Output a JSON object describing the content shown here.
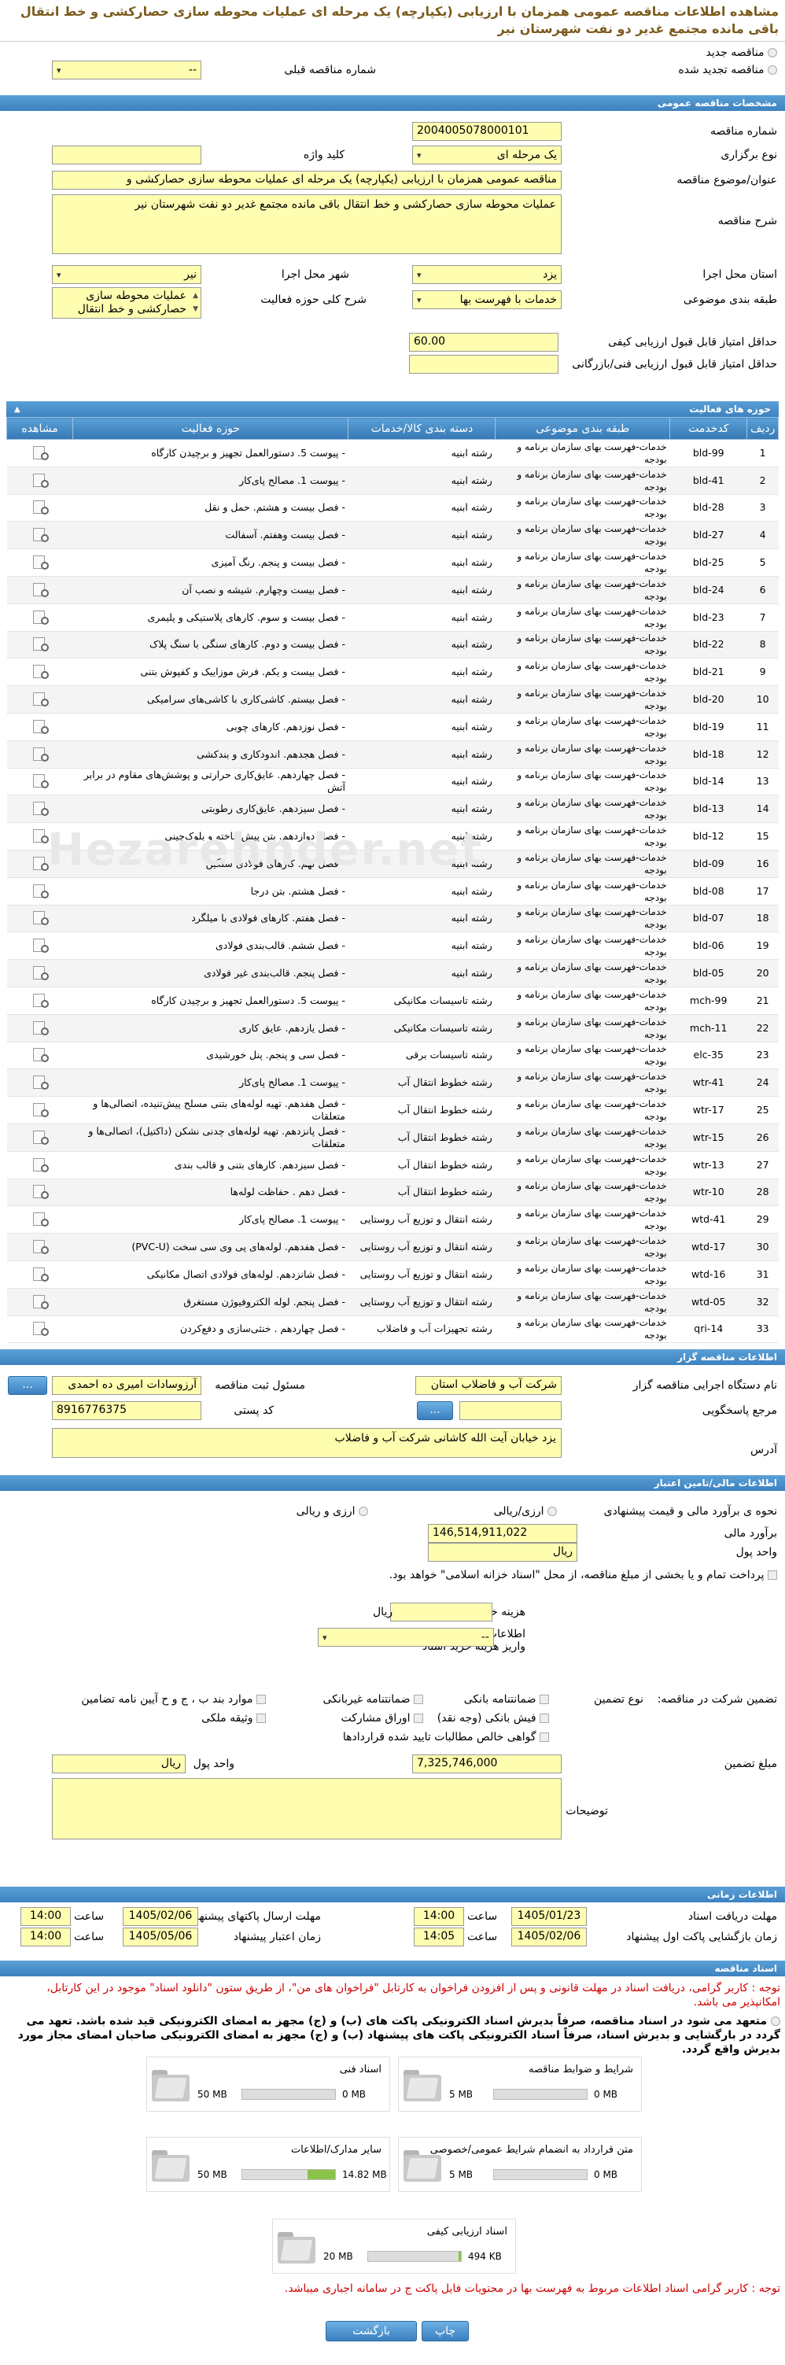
{
  "page_title": "مشاهده اطلاعات مناقصه عمومی همزمان با ارزیابی (یکپارچه) یک مرحله ای عملیات محوطه سازی حصارکشی و خط انتقال باقی مانده مجتمع غدیر دو نفت شهرستان نیر",
  "top": {
    "new_tender": "مناقصه جدید",
    "renewed_tender": "مناقصه تجدید شده",
    "prev_number_label": "شماره مناقصه قبلی",
    "prev_number_value": "--"
  },
  "general": {
    "section": "مشخصات مناقصه عمومی",
    "number_label": "شماره مناقصه",
    "number_value": "2004005078000101",
    "type_label": "نوع برگزاری",
    "type_value": "یک مرحله ای",
    "keyword_label": "کلید واژه",
    "subject_label": "عنوان/موضوع مناقصه",
    "subject_value": "مناقصه عمومی همزمان با ارزیابی (یکپارچه) یک مرحله ای عملیات محوطه سازی حصارکشی و",
    "desc_label": "شرح مناقصه",
    "desc_value": "عملیات محوطه سازی حصارکشی و خط انتقال باقی مانده مجتمع غدیر دو نفت شهرستان نیر",
    "province_label": "استان محل اجرا",
    "province_value": "یزد",
    "city_label": "شهر محل اجرا",
    "city_value": "نیر",
    "category_label": "طبقه بندی موضوعی",
    "category_value": "خدمات با فهرست بها",
    "scope_label": "شرح کلی حوزه فعالیت",
    "scope_value": "عملیات محوطه سازی حصارکشی و خط انتقال",
    "min_score_label": "حداقل امتیاز قابل قبول ارزیابی کیفی",
    "min_score_value": "60.00",
    "min_tech_label": "حداقل امتیاز قابل قبول ارزیابی فنی/بازرگانی"
  },
  "activities": {
    "section": "حوزه های فعالیت",
    "headers": [
      "ردیف",
      "کدخدمت",
      "طبقه بندی موضوعی",
      "دسته بندی کالا/خدمات",
      "حوزه فعالیت",
      "مشاهده"
    ],
    "rows": [
      [
        "1",
        "bld-99",
        "خدمات-فهرست بهای سازمان برنامه و بودجه",
        "رشته ابنیه",
        "- پیوست 5. دستورالعمل تجهیز و برچیدن کارگاه"
      ],
      [
        "2",
        "bld-41",
        "خدمات-فهرست بهای سازمان برنامه و بودجه",
        "رشته ابنیه",
        "- پیوست 1. مصالح پای‌کار"
      ],
      [
        "3",
        "bld-28",
        "خدمات-فهرست بهای سازمان برنامه و بودجه",
        "رشته ابنیه",
        "- فصل بیست و هشتم. حمل و نقل"
      ],
      [
        "4",
        "bld-27",
        "خدمات-فهرست بهای سازمان برنامه و بودجه",
        "رشته ابنیه",
        "- فصل بیست وهفتم. آسفالت"
      ],
      [
        "5",
        "bld-25",
        "خدمات-فهرست بهای سازمان برنامه و بودجه",
        "رشته ابنیه",
        "- فصل بیست و پنجم. رنگ آمیزی"
      ],
      [
        "6",
        "bld-24",
        "خدمات-فهرست بهای سازمان برنامه و بودجه",
        "رشته ابنیه",
        "- فصل بیست وچهارم. شیشه و نصب آن"
      ],
      [
        "7",
        "bld-23",
        "خدمات-فهرست بهای سازمان برنامه و بودجه",
        "رشته ابنیه",
        "- فصل بیست و سوم. کارهای پلاستیکی و پلیمری"
      ],
      [
        "8",
        "bld-22",
        "خدمات-فهرست بهای سازمان برنامه و بودجه",
        "رشته ابنیه",
        "- فصل بیست و دوم. کارهای سنگی با سنگ پلاک"
      ],
      [
        "9",
        "bld-21",
        "خدمات-فهرست بهای سازمان برنامه و بودجه",
        "رشته ابنیه",
        "- فصل بیست و یکم. فرش موزاییک و کفپوش بتنی"
      ],
      [
        "10",
        "bld-20",
        "خدمات-فهرست بهای سازمان برنامه و بودجه",
        "رشته ابنیه",
        "- فصل بیستم. کاشی‌کاری با کاشی‌های سرامیکی"
      ],
      [
        "11",
        "bld-19",
        "خدمات-فهرست بهای سازمان برنامه و بودجه",
        "رشته ابنیه",
        "- فصل نوزدهم. کارهای چوبی"
      ],
      [
        "12",
        "bld-18",
        "خدمات-فهرست بهای سازمان برنامه و بودجه",
        "رشته ابنیه",
        "- فصل هجدهم. اندودکاری و بندکشی"
      ],
      [
        "13",
        "bld-14",
        "خدمات-فهرست بهای سازمان برنامه و بودجه",
        "رشته ابنیه",
        "- فصل چهاردهم. عایق‌کاری حرارتی و پوشش‌های مقاوم در برابر آتش"
      ],
      [
        "14",
        "bld-13",
        "خدمات-فهرست بهای سازمان برنامه و بودجه",
        "رشته ابنیه",
        "- فصل سیزدهم. عایق‌کاری رطوبتی"
      ],
      [
        "15",
        "bld-12",
        "خدمات-فهرست بهای سازمان برنامه و بودجه",
        "رشته ابنیه",
        "- فصل دوازدهم. بتن پیش‌ساخته و بلوک‌چینی"
      ],
      [
        "16",
        "bld-09",
        "خدمات-فهرست بهای سازمان برنامه و بودجه",
        "رشته ابنیه",
        "- فصل نهم. کارهای فولادی سنگین"
      ],
      [
        "17",
        "bld-08",
        "خدمات-فهرست بهای سازمان برنامه و بودجه",
        "رشته ابنیه",
        "- فصل هشتم. بتن درجا"
      ],
      [
        "18",
        "bld-07",
        "خدمات-فهرست بهای سازمان برنامه و بودجه",
        "رشته ابنیه",
        "- فصل هفتم. کارهای فولادی با میلگرد"
      ],
      [
        "19",
        "bld-06",
        "خدمات-فهرست بهای سازمان برنامه و بودجه",
        "رشته ابنیه",
        "- فصل ششم. قالب‌بندی فولادی"
      ],
      [
        "20",
        "bld-05",
        "خدمات-فهرست بهای سازمان برنامه و بودجه",
        "رشته ابنیه",
        "- فصل پنجم. قالب‌بندی غیر فولادی"
      ],
      [
        "21",
        "mch-99",
        "خدمات-فهرست بهای سازمان برنامه و بودجه",
        "رشته تاسیسات مکانیکی",
        "- پیوست 5. دستورالعمل تجهیز و برچیدن کارگاه"
      ],
      [
        "22",
        "mch-11",
        "خدمات-فهرست بهای سازمان برنامه و بودجه",
        "رشته تاسیسات مکانیکی",
        "- فصل یازدهم. عایق کاری"
      ],
      [
        "23",
        "elc-35",
        "خدمات-فهرست بهای سازمان برنامه و بودجه",
        "رشته تاسیسات برقی",
        "- فصل سی و پنجم. پنل خورشیدی"
      ],
      [
        "24",
        "wtr-41",
        "خدمات-فهرست بهای سازمان برنامه و بودجه",
        "رشته خطوط انتقال آب",
        "- پیوست 1. مصالح پای‌کار"
      ],
      [
        "25",
        "wtr-17",
        "خدمات-فهرست بهای سازمان برنامه و بودجه",
        "رشته خطوط انتقال آب",
        "- فصل هفدهم. تهیه لوله‌های بتنی مسلح پیش‌تنیده، اتصالی‌ها و متعلقات"
      ],
      [
        "26",
        "wtr-15",
        "خدمات-فهرست بهای سازمان برنامه و بودجه",
        "رشته خطوط انتقال آب",
        "- فصل پانزدهم. تهیه لوله‌های چدنی نشکن (داکتیل)، اتصالی‌ها و متعلقات"
      ],
      [
        "27",
        "wtr-13",
        "خدمات-فهرست بهای سازمان برنامه و بودجه",
        "رشته خطوط انتقال آب",
        "- فصل سیزدهم. کارهای بتنی و قالب بندی"
      ],
      [
        "28",
        "wtr-10",
        "خدمات-فهرست بهای سازمان برنامه و بودجه",
        "رشته خطوط انتقال آب",
        "- فصل دهم . حفاظت لوله‌ها"
      ],
      [
        "29",
        "wtd-41",
        "خدمات-فهرست بهای سازمان برنامه و بودجه",
        "رشته انتقال و توزیع آب روستایی",
        "- پیوست 1. مصالح پای‌کار"
      ],
      [
        "30",
        "wtd-17",
        "خدمات-فهرست بهای سازمان برنامه و بودجه",
        "رشته انتقال و توزیع آب روستایی",
        "- فصل هفدهم. لوله‌های پی وی سی سخت (PVC-U)"
      ],
      [
        "31",
        "wtd-16",
        "خدمات-فهرست بهای سازمان برنامه و بودجه",
        "رشته انتقال و توزیع آب روستایی",
        "- فصل شانزدهم. لوله‌های فولادی اتصال مکانیکی"
      ],
      [
        "32",
        "wtd-05",
        "خدمات-فهرست بهای سازمان برنامه و بودجه",
        "رشته انتقال و توزیع آب روستایی",
        "- فصل پنجم. لوله الکتروفیوژن مستغرق"
      ],
      [
        "33",
        "qri-14",
        "خدمات-فهرست بهای سازمان برنامه و بودجه",
        "رشته تجهیزات آب و فاضلاب",
        "- فصل چهاردهم . خنثی‌سازی و دفع‌کردن"
      ]
    ]
  },
  "organizer": {
    "section": "اطلاعات مناقصه گزار",
    "org_label": "نام دستگاه اجرایی مناقصه گزار",
    "org_value": "شرکت آب و فاضلاب استان",
    "registrar_label": "مسئول ثبت مناقصه",
    "registrar_value": "آرزوسادات امیری ده احمدی",
    "ref_label": "مرجع پاسخگویی",
    "btn_dots": "...",
    "postal_label": "کد پستی",
    "postal_value": "8916776375",
    "address_label": "آدرس",
    "address_value": "یزد خیابان آیت الله کاشانی شرکت آب و فاضلاب"
  },
  "financial": {
    "section": "اطلاعات مالی/تامین اعتبار",
    "method_label": "نحوه ی برآورد مالی و قیمت پیشنهادی",
    "rial": "ارزی/ریالی",
    "rial_fx": "ارزی و ریالی",
    "estimate_label": "برآورد مالی",
    "estimate_value": "146,514,911,022",
    "unit_label": "واحد پول",
    "unit_value": "ریال",
    "treasury_note": "پرداخت تمام و یا بخشی از مبلغ مناقصه، از محل \"اسناد خزانه اسلامی\" خواهد بود.",
    "purchase_cost_label": "هزینه خرید اسناد",
    "purchase_cost_unit": "ریال",
    "account_label": "اطلاعات حساب جهت واریز هزینه خرید اسناد",
    "account_value": "--"
  },
  "guarantee": {
    "label": "تضمین شرکت در مناقصه:",
    "type_label": "نوع تضمین",
    "options": [
      "ضمانتنامه بانکی",
      "ضمانتنامه غیربانکی",
      "موارد بند ب ، ج و ح آیین نامه تضامین",
      "فیش بانکی (وجه نقد)",
      "اوراق مشارکت",
      "وثیقه ملکی",
      "گواهی خالص مطالبات تایید شده قراردادها"
    ],
    "amount_label": "مبلغ تضمین",
    "amount_value": "7,325,746,000",
    "unit_label": "واحد پول",
    "unit_value": "ریال",
    "notes_label": "توضیحات"
  },
  "timing": {
    "section": "اطلاعات زمانی",
    "receive_label": "مهلت دریافت اسناد",
    "receive_date": "1405/01/23",
    "receive_time": "14:00",
    "send_label": "مهلت ارسال پاکتهای پیشنهاد",
    "send_date": "1405/02/06",
    "send_time": "14:00",
    "open_label": "زمان بازگشایی پاکت اول پیشنهاد",
    "open_date": "1405/02/06",
    "open_time": "14:05",
    "validity_label": "زمان اعتبار پیشنهاد",
    "validity_date": "1405/05/06",
    "validity_time": "14:00",
    "time_word": "ساعت"
  },
  "docs": {
    "section": "اسناد مناقصه",
    "note1": "توجه : کاربر گرامی، دریافت اسناد در مهلت قانونی و پس از افزودن فراخوان به کارتابل \"فراخوان های من\"، از طریق ستون \"دانلود اسناد\" موجود در این کارتابل، امکانپذیر می باشد.",
    "note2": "متعهد می شود در اسناد مناقصه، صرفاً بدیرش اسناد الکترونیکی پاکت های (ب) و (ج) مجهز به امضای الکترونیکی قید شده باشد. تعهد می گردد در بارگشایی و بدیرش اسناد، صرفاً اسناد الکترونیکی پاکت های پیشنهاد (ب) و (ج) مجهز به امضای الکترونیکی صاحبان امضای مجاز مورد بدیرش واقع گردد.",
    "cards": [
      {
        "title": "شرایط و ضوابط مناقصه",
        "used": "0 MB",
        "total": "5 MB",
        "pct": 0
      },
      {
        "title": "اسناد فنی",
        "used": "0 MB",
        "total": "50 MB",
        "pct": 0
      },
      {
        "title": "متن قرارداد به انضمام شرایط عمومی/خصوصی",
        "used": "0 MB",
        "total": "5 MB",
        "pct": 0
      },
      {
        "title": "سایر مدارک/اطلاعات",
        "used": "14.82 MB",
        "total": "50 MB",
        "pct": 0.3
      },
      {
        "title": "اسناد ارزیابی کیفی",
        "used": "494 KB",
        "total": "20 MB",
        "pct": 0.025
      }
    ],
    "note3": "توجه : کاربر گرامی اسناد اطلاعات مربوط به فهرست بها در محتویات فایل پاکت ج در سامانه اجباری میباشد."
  },
  "buttons": {
    "return": "بازگشت",
    "print": "چاپ"
  },
  "watermark": "Hezarehnder.net"
}
